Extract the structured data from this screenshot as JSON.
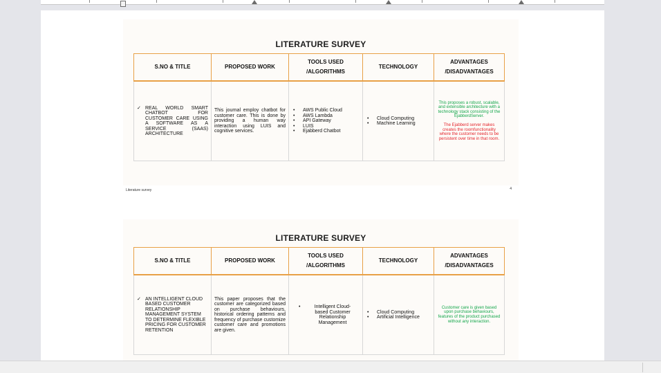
{
  "slides": [
    {
      "title": "LITERATURE SURVEY",
      "headers": [
        "S.NO & TITLE",
        "PROPOSED WORK",
        "TOOLS USED /ALGORITHMS",
        "TECHNOLOGY",
        "ADVANTAGES /DISADVANTAGES"
      ],
      "row": {
        "check": "✓",
        "title": "REAL WORLD SMART CHATBOT FOR CUSTOMER CARE USING A SOFTWARE AS A SERVICE (SAAS) ARCHITECTURE",
        "proposed": "This journal employ chatbot for customer care. This is done by providing a human way interaction using LUIS and cognitive services.",
        "tools": [
          "AWS Public Cloud",
          "AWS Lambda",
          "API Gateway",
          "LUIS",
          "Ejabberd Chatbot"
        ],
        "technology": [
          "Cloud Computing",
          "Machine Learning"
        ],
        "advantage": "This proposes a robust, scalable, and extensible architecture with a technology stack consisting of the EjabberdServer.",
        "disadvantage": "The Ejabberd server makes creates the roomfunctionality where the customer needs to be persistent over time in that room."
      },
      "footer": "Literature survey",
      "page_number": "4"
    },
    {
      "title": "LITERATURE SURVEY",
      "headers": [
        "S.NO & TITLE",
        "PROPOSED WORK",
        "TOOLS USED /ALGORITHMS",
        "TECHNOLOGY",
        "ADVANTAGES /DISADVANTAGES"
      ],
      "row": {
        "check": "✓",
        "title": "AN INTELLIGENT CLOUD BASED CUSTOMER RELATIONSHIP MANAGEMENT SYSTEM TO DETERMINE FLEXIBLE PRICING FOR CUSTOMER RETENTION",
        "proposed": "This paper proposes that the customer are categorized based on purchase behaviours, historical ordering patterns and frequency of purchase customize customer care and promotions are given.",
        "tools": [
          "Intelligent Cloud-based Customer Relationship Management"
        ],
        "technology": [
          "Cloud Computing",
          "Artificial Intelligence"
        ],
        "advantage": "Customer care is given based upon purchase behaviours, features of the product purchased without any interaction."
      }
    }
  ],
  "colors": {
    "header_border": "#e8a046",
    "advantage_text": "#13a64a",
    "disadvantage_text": "#e4242b"
  }
}
